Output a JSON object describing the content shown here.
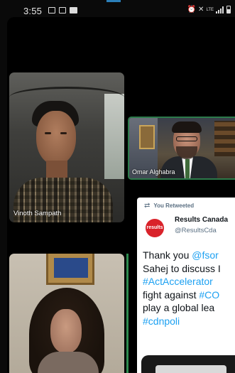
{
  "status_bar": {
    "time": "3:55",
    "left_icons": [
      "gallery-icon",
      "cast-icon",
      "video-icon"
    ],
    "right_icons": [
      "alarm-icon",
      "mute-icon",
      "lte-icon",
      "signal-icon",
      "battery-icon"
    ],
    "network": "LTE"
  },
  "participants": [
    {
      "name": "Vinoth Sampath"
    },
    {
      "name": "Omar Alghabra"
    },
    {
      "name": ""
    }
  ],
  "tweet": {
    "retweet_label": "You Retweeted",
    "logo_text": "results",
    "author": "Results Canada",
    "handle": "@ResultsCda",
    "body_lines": [
      {
        "text": "Thank you ",
        "link": "@fsor"
      },
      {
        "text": "Sahej to discuss I",
        "link": ""
      },
      {
        "text": "",
        "link": "#ActAccelerator"
      },
      {
        "text": "fight against ",
        "link": "#CO"
      },
      {
        "text": "play a global lea",
        "link": ""
      },
      {
        "text": "",
        "link": "#cdnpoli"
      }
    ]
  },
  "colors": {
    "twitter_blue": "#1da1f2",
    "results_red": "#d9222a",
    "active_speaker_green": "#2e8b4f"
  }
}
